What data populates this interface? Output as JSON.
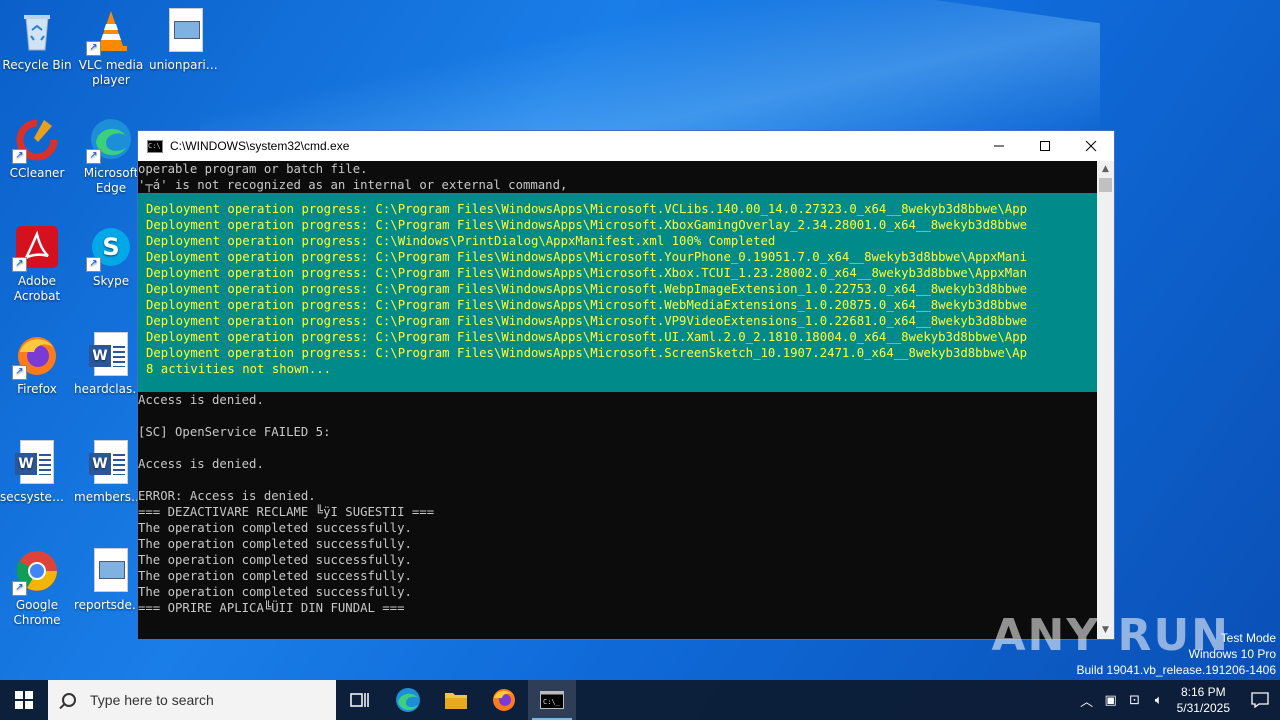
{
  "desktop": {
    "icons": [
      {
        "label": "Recycle Bin"
      },
      {
        "label": "VLC media player"
      },
      {
        "label": "unionparis..."
      },
      {
        "label": "CCleaner"
      },
      {
        "label": "Microsoft Edge"
      },
      {
        "label": "Adobe Acrobat"
      },
      {
        "label": "Skype"
      },
      {
        "label": "Firefox"
      },
      {
        "label": "heardclassi..."
      },
      {
        "label": "secsystems..."
      },
      {
        "label": "membersfi..."
      },
      {
        "label": "Google Chrome"
      },
      {
        "label": "reportsdes..."
      }
    ]
  },
  "cmd": {
    "title": "C:\\WINDOWS\\system32\\cmd.exe",
    "top_lines": [
      "operable program or batch file.",
      "'┬á' is not recognized as an internal or external command,"
    ],
    "progress_lines": [
      "Deployment operation progress: C:\\Program Files\\WindowsApps\\Microsoft.VCLibs.140.00_14.0.27323.0_x64__8wekyb3d8bbwe\\App",
      "Deployment operation progress: C:\\Program Files\\WindowsApps\\Microsoft.XboxGamingOverlay_2.34.28001.0_x64__8wekyb3d8bbwe",
      "Deployment operation progress: C:\\Windows\\PrintDialog\\AppxManifest.xml 100% Completed",
      "Deployment operation progress: C:\\Program Files\\WindowsApps\\Microsoft.YourPhone_0.19051.7.0_x64__8wekyb3d8bbwe\\AppxMani",
      "Deployment operation progress: C:\\Program Files\\WindowsApps\\Microsoft.Xbox.TCUI_1.23.28002.0_x64__8wekyb3d8bbwe\\AppxMan",
      "Deployment operation progress: C:\\Program Files\\WindowsApps\\Microsoft.WebpImageExtension_1.0.22753.0_x64__8wekyb3d8bbwe",
      "Deployment operation progress: C:\\Program Files\\WindowsApps\\Microsoft.WebMediaExtensions_1.0.20875.0_x64__8wekyb3d8bbwe",
      "Deployment operation progress: C:\\Program Files\\WindowsApps\\Microsoft.VP9VideoExtensions_1.0.22681.0_x64__8wekyb3d8bbwe",
      "Deployment operation progress: C:\\Program Files\\WindowsApps\\Microsoft.UI.Xaml.2.0_2.1810.18004.0_x64__8wekyb3d8bbwe\\App",
      "Deployment operation progress: C:\\Program Files\\WindowsApps\\Microsoft.ScreenSketch_10.1907.2471.0_x64__8wekyb3d8bbwe\\Ap",
      "8 activities not shown..."
    ],
    "bottom_lines": [
      "Access is denied.",
      "",
      "[SC] OpenService FAILED 5:",
      "",
      "Access is denied.",
      "",
      "ERROR: Access is denied.",
      "=== DEZACTIVARE RECLAME ╚ÿI SUGESTII ===",
      "The operation completed successfully.",
      "The operation completed successfully.",
      "The operation completed successfully.",
      "The operation completed successfully.",
      "The operation completed successfully.",
      "=== OPRIRE APLICA╚ÜII DIN FUNDAL ==="
    ],
    "colors": {
      "progress_bg": "#008a8a",
      "progress_text": "#ffff3c",
      "text": "#c8c8c8",
      "bg": "#0c0c0c"
    }
  },
  "watermark": {
    "brand": "ANY RUN",
    "mode": "Test Mode",
    "edition": "Windows 10 Pro",
    "build": "Build 19041.vb_release.191206-1406"
  },
  "taskbar": {
    "search_placeholder": "Type here to search",
    "time": "8:16 PM",
    "date": "5/31/2025"
  }
}
